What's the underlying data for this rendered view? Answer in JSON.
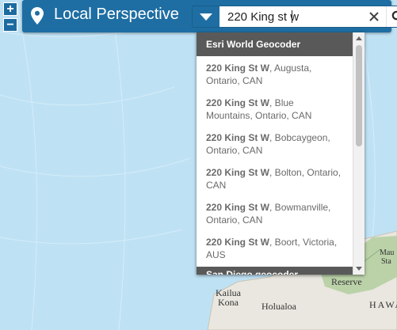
{
  "header": {
    "title": "Local Perspective"
  },
  "zoom": {
    "in_label": "+",
    "out_label": "−"
  },
  "search": {
    "value": "220 King st w",
    "source_menu_icon": "caret-down-icon",
    "clear_icon": "close-icon",
    "search_icon": "magnifier-icon"
  },
  "results": {
    "groups": [
      {
        "name": "Esri World Geocoder",
        "items": [
          {
            "match": "220 King St W",
            "rest": ", Augusta,",
            "line2": "Ontario, CAN"
          },
          {
            "match": "220 King St W",
            "rest": ", Blue",
            "line2": "Mountains, Ontario, CAN"
          },
          {
            "match": "220 King St W",
            "rest": ", Bobcaygeon,",
            "line2": "Ontario, CAN"
          },
          {
            "match": "220 King St W",
            "rest": ", Bolton, Ontario,",
            "line2": "CAN"
          },
          {
            "match": "220 King St W",
            "rest": ", Bowmanville,",
            "line2": "Ontario, CAN"
          },
          {
            "match": "220 King St W",
            "rest": ", Boort, Victoria,",
            "line2": "AUS"
          }
        ]
      },
      {
        "name": "San Diego geocoder"
      }
    ]
  },
  "map": {
    "labels": {
      "kailua_kona": "Kailua\nKona",
      "holualoa": "Holualoa",
      "reserve": "Reserve",
      "hawaii": "HAWAI",
      "mauna": "Mau",
      "state": "Sta"
    },
    "colors": {
      "ocean": "#bfe1f4",
      "land": "#e9e7df",
      "forest": "#b6cfa3",
      "accent": "#1e6ea3"
    }
  }
}
